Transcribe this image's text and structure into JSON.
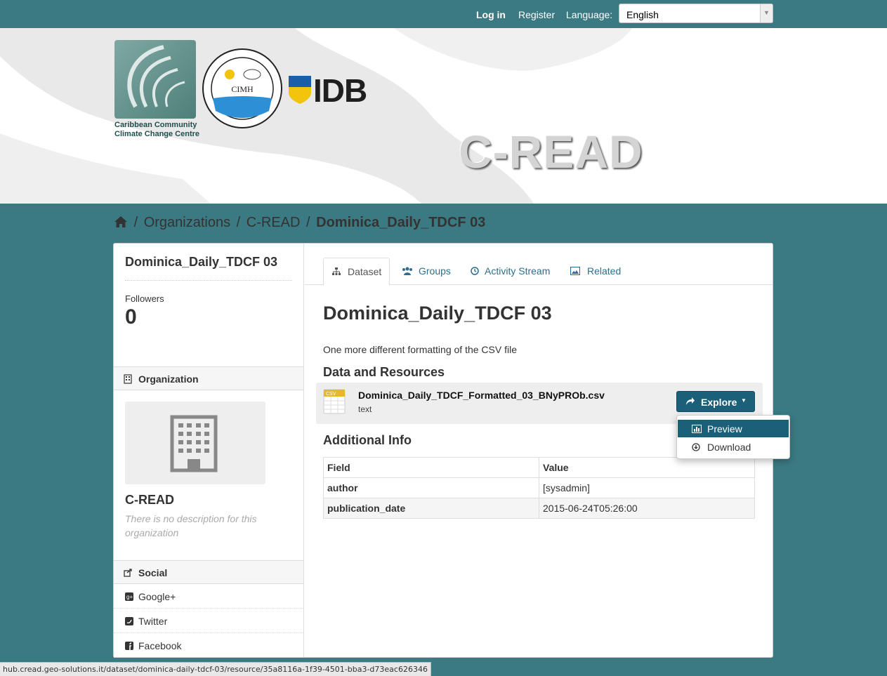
{
  "account": {
    "login": "Log in",
    "register": "Register",
    "language_label": "Language:",
    "language_value": "English"
  },
  "masthead": {
    "ccccc_line1": "Caribbean Community",
    "ccccc_line2": "Climate Change Centre",
    "cimh": "CIMH",
    "idb": "IDB",
    "site_title": "C-READ"
  },
  "breadcrumb": {
    "organizations": "Organizations",
    "org": "C-READ",
    "current": "Dominica_Daily_TDCF 03",
    "sep": "/"
  },
  "aside": {
    "title": "Dominica_Daily_TDCF 03",
    "followers_label": "Followers",
    "followers_value": "0",
    "org_heading": "Organization",
    "org_name": "C-READ",
    "org_desc": "There is no description for this organization",
    "social_heading": "Social",
    "social": [
      "Google+",
      "Twitter",
      "Facebook"
    ]
  },
  "tabs": [
    "Dataset",
    "Groups",
    "Activity Stream",
    "Related"
  ],
  "dataset": {
    "title": "Dominica_Daily_TDCF 03",
    "notes": "One more different formatting of the CSV file",
    "resources_heading": "Data and Resources",
    "resource_name": "Dominica_Daily_TDCF_Formatted_03_BNyPROb.csv",
    "resource_format": "text",
    "explore": "Explore",
    "menu": [
      "Preview",
      "Download"
    ],
    "additional_heading": "Additional Info",
    "table_headers": [
      "Field",
      "Value"
    ],
    "rows": [
      {
        "field": "author",
        "value": "[sysadmin]"
      },
      {
        "field": "publication_date",
        "value": "2015-06-24T05:26:00"
      }
    ]
  },
  "status_url": "hub.cread.geo-solutions.it/dataset/dominica-daily-tdcf-03/resource/35a8116a-1f39-4501-bba3-d73eac626346",
  "colors": {
    "teal": "#3b7a82",
    "accent": "#1b5f79",
    "link": "#2c6e8c"
  }
}
